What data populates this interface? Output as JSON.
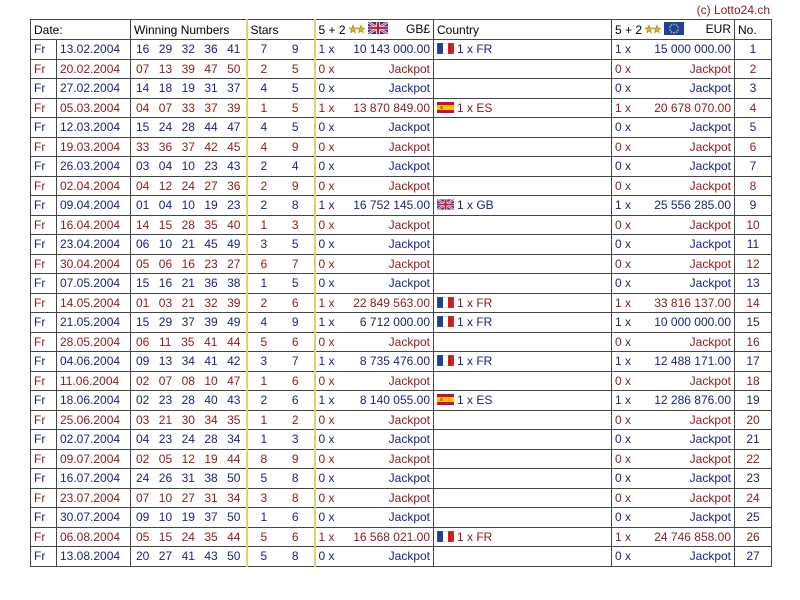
{
  "credit": "(c) Lotto24.ch",
  "headers": {
    "date": "Date:",
    "numbers": "Winning Numbers",
    "stars": "Stars",
    "gb_combo": "5 + 2",
    "gb_currency": "GB£",
    "country": "Country",
    "eur_combo": "5 + 2",
    "eur_currency": "EUR",
    "no": "No."
  },
  "colors": {
    "blue": "#1a237e",
    "red": "#8b1a1a",
    "stars_border": "#e0d070"
  },
  "rows": [
    {
      "day": "Fr",
      "date": "13.02.2004",
      "n": [
        "16",
        "29",
        "32",
        "36",
        "41"
      ],
      "s": [
        "7",
        "9"
      ],
      "gbw": "1 x",
      "gbp": "10 143 000.00",
      "country": "1 x FR",
      "flag": "FR",
      "ew": "1 x",
      "ep": "15 000 000.00",
      "no": "1"
    },
    {
      "day": "Fr",
      "date": "20.02.2004",
      "n": [
        "07",
        "13",
        "39",
        "47",
        "50"
      ],
      "s": [
        "2",
        "5"
      ],
      "gbw": "0 x",
      "gbp": "Jackpot",
      "country": "",
      "flag": "",
      "ew": "0 x",
      "ep": "Jackpot",
      "no": "2"
    },
    {
      "day": "Fr",
      "date": "27.02.2004",
      "n": [
        "14",
        "18",
        "19",
        "31",
        "37"
      ],
      "s": [
        "4",
        "5"
      ],
      "gbw": "0 x",
      "gbp": "Jackpot",
      "country": "",
      "flag": "",
      "ew": "0 x",
      "ep": "Jackpot",
      "no": "3"
    },
    {
      "day": "Fr",
      "date": "05.03.2004",
      "n": [
        "04",
        "07",
        "33",
        "37",
        "39"
      ],
      "s": [
        "1",
        "5"
      ],
      "gbw": "1 x",
      "gbp": "13 870 849.00",
      "country": "1 x ES",
      "flag": "ES",
      "ew": "1 x",
      "ep": "20 678 070.00",
      "no": "4"
    },
    {
      "day": "Fr",
      "date": "12.03.2004",
      "n": [
        "15",
        "24",
        "28",
        "44",
        "47"
      ],
      "s": [
        "4",
        "5"
      ],
      "gbw": "0 x",
      "gbp": "Jackpot",
      "country": "",
      "flag": "",
      "ew": "0 x",
      "ep": "Jackpot",
      "no": "5"
    },
    {
      "day": "Fr",
      "date": "19.03.2004",
      "n": [
        "33",
        "36",
        "37",
        "42",
        "45"
      ],
      "s": [
        "4",
        "9"
      ],
      "gbw": "0 x",
      "gbp": "Jackpot",
      "country": "",
      "flag": "",
      "ew": "0 x",
      "ep": "Jackpot",
      "no": "6"
    },
    {
      "day": "Fr",
      "date": "26.03.2004",
      "n": [
        "03",
        "04",
        "10",
        "23",
        "43"
      ],
      "s": [
        "2",
        "4"
      ],
      "gbw": "0 x",
      "gbp": "Jackpot",
      "country": "",
      "flag": "",
      "ew": "0 x",
      "ep": "Jackpot",
      "no": "7"
    },
    {
      "day": "Fr",
      "date": "02.04.2004",
      "n": [
        "04",
        "12",
        "24",
        "27",
        "36"
      ],
      "s": [
        "2",
        "9"
      ],
      "gbw": "0 x",
      "gbp": "Jackpot",
      "country": "",
      "flag": "",
      "ew": "0 x",
      "ep": "Jackpot",
      "no": "8"
    },
    {
      "day": "Fr",
      "date": "09.04.2004",
      "n": [
        "01",
        "04",
        "10",
        "19",
        "23"
      ],
      "s": [
        "2",
        "8"
      ],
      "gbw": "1 x",
      "gbp": "16 752 145.00",
      "country": "1 x GB",
      "flag": "GB",
      "ew": "1 x",
      "ep": "25 556 285.00",
      "no": "9"
    },
    {
      "day": "Fr",
      "date": "16.04.2004",
      "n": [
        "14",
        "15",
        "28",
        "35",
        "40"
      ],
      "s": [
        "1",
        "3"
      ],
      "gbw": "0 x",
      "gbp": "Jackpot",
      "country": "",
      "flag": "",
      "ew": "0 x",
      "ep": "Jackpot",
      "no": "10"
    },
    {
      "day": "Fr",
      "date": "23.04.2004",
      "n": [
        "06",
        "10",
        "21",
        "45",
        "49"
      ],
      "s": [
        "3",
        "5"
      ],
      "gbw": "0 x",
      "gbp": "Jackpot",
      "country": "",
      "flag": "",
      "ew": "0 x",
      "ep": "Jackpot",
      "no": "11"
    },
    {
      "day": "Fr",
      "date": "30.04.2004",
      "n": [
        "05",
        "06",
        "16",
        "23",
        "27"
      ],
      "s": [
        "6",
        "7"
      ],
      "gbw": "0 x",
      "gbp": "Jackpot",
      "country": "",
      "flag": "",
      "ew": "0 x",
      "ep": "Jackpot",
      "no": "12"
    },
    {
      "day": "Fr",
      "date": "07.05.2004",
      "n": [
        "15",
        "16",
        "21",
        "36",
        "38"
      ],
      "s": [
        "1",
        "5"
      ],
      "gbw": "0 x",
      "gbp": "Jackpot",
      "country": "",
      "flag": "",
      "ew": "0 x",
      "ep": "Jackpot",
      "no": "13"
    },
    {
      "day": "Fr",
      "date": "14.05.2004",
      "n": [
        "01",
        "03",
        "21",
        "32",
        "39"
      ],
      "s": [
        "2",
        "6"
      ],
      "gbw": "1 x",
      "gbp": "22 849 563.00",
      "country": "1 x FR",
      "flag": "FR",
      "ew": "1 x",
      "ep": "33 816 137.00",
      "no": "14"
    },
    {
      "day": "Fr",
      "date": "21.05.2004",
      "n": [
        "15",
        "29",
        "37",
        "39",
        "49"
      ],
      "s": [
        "4",
        "9"
      ],
      "gbw": "1 x",
      "gbp": "6 712 000.00",
      "country": "1 x FR",
      "flag": "FR",
      "ew": "1 x",
      "ep": "10 000 000.00",
      "no": "15"
    },
    {
      "day": "Fr",
      "date": "28.05.2004",
      "n": [
        "06",
        "11",
        "35",
        "41",
        "44"
      ],
      "s": [
        "5",
        "6"
      ],
      "gbw": "0 x",
      "gbp": "Jackpot",
      "country": "",
      "flag": "",
      "ew": "0 x",
      "ep": "Jackpot",
      "no": "16"
    },
    {
      "day": "Fr",
      "date": "04.06.2004",
      "n": [
        "09",
        "13",
        "34",
        "41",
        "42"
      ],
      "s": [
        "3",
        "7"
      ],
      "gbw": "1 x",
      "gbp": "8 735 476.00",
      "country": "1 x FR",
      "flag": "FR",
      "ew": "1 x",
      "ep": "12 488 171.00",
      "no": "17"
    },
    {
      "day": "Fr",
      "date": "11.06.2004",
      "n": [
        "02",
        "07",
        "08",
        "10",
        "47"
      ],
      "s": [
        "1",
        "6"
      ],
      "gbw": "0 x",
      "gbp": "Jackpot",
      "country": "",
      "flag": "",
      "ew": "0 x",
      "ep": "Jackpot",
      "no": "18"
    },
    {
      "day": "Fr",
      "date": "18.06.2004",
      "n": [
        "02",
        "23",
        "28",
        "40",
        "43"
      ],
      "s": [
        "2",
        "6"
      ],
      "gbw": "1 x",
      "gbp": "8 140 055.00",
      "country": "1 x ES",
      "flag": "ES",
      "ew": "1 x",
      "ep": "12 286 876.00",
      "no": "19"
    },
    {
      "day": "Fr",
      "date": "25.06.2004",
      "n": [
        "03",
        "21",
        "30",
        "34",
        "35"
      ],
      "s": [
        "1",
        "2"
      ],
      "gbw": "0 x",
      "gbp": "Jackpot",
      "country": "",
      "flag": "",
      "ew": "0 x",
      "ep": "Jackpot",
      "no": "20"
    },
    {
      "day": "Fr",
      "date": "02.07.2004",
      "n": [
        "04",
        "23",
        "24",
        "28",
        "34"
      ],
      "s": [
        "1",
        "3"
      ],
      "gbw": "0 x",
      "gbp": "Jackpot",
      "country": "",
      "flag": "",
      "ew": "0 x",
      "ep": "Jackpot",
      "no": "21"
    },
    {
      "day": "Fr",
      "date": "09.07.2004",
      "n": [
        "02",
        "05",
        "12",
        "19",
        "44"
      ],
      "s": [
        "8",
        "9"
      ],
      "gbw": "0 x",
      "gbp": "Jackpot",
      "country": "",
      "flag": "",
      "ew": "0 x",
      "ep": "Jackpot",
      "no": "22"
    },
    {
      "day": "Fr",
      "date": "16.07.2004",
      "n": [
        "24",
        "26",
        "31",
        "38",
        "50"
      ],
      "s": [
        "5",
        "8"
      ],
      "gbw": "0 x",
      "gbp": "Jackpot",
      "country": "",
      "flag": "",
      "ew": "0 x",
      "ep": "Jackpot",
      "no": "23"
    },
    {
      "day": "Fr",
      "date": "23.07.2004",
      "n": [
        "07",
        "10",
        "27",
        "31",
        "34"
      ],
      "s": [
        "3",
        "8"
      ],
      "gbw": "0 x",
      "gbp": "Jackpot",
      "country": "",
      "flag": "",
      "ew": "0 x",
      "ep": "Jackpot",
      "no": "24"
    },
    {
      "day": "Fr",
      "date": "30.07.2004",
      "n": [
        "09",
        "10",
        "19",
        "37",
        "50"
      ],
      "s": [
        "1",
        "6"
      ],
      "gbw": "0 x",
      "gbp": "Jackpot",
      "country": "",
      "flag": "",
      "ew": "0 x",
      "ep": "Jackpot",
      "no": "25"
    },
    {
      "day": "Fr",
      "date": "06.08.2004",
      "n": [
        "05",
        "15",
        "24",
        "35",
        "44"
      ],
      "s": [
        "5",
        "6"
      ],
      "gbw": "1 x",
      "gbp": "16 568 021.00",
      "country": "1 x FR",
      "flag": "FR",
      "ew": "1 x",
      "ep": "24 746 858.00",
      "no": "26"
    },
    {
      "day": "Fr",
      "date": "13.08.2004",
      "n": [
        "20",
        "27",
        "41",
        "43",
        "50"
      ],
      "s": [
        "5",
        "8"
      ],
      "gbw": "0 x",
      "gbp": "Jackpot",
      "country": "",
      "flag": "",
      "ew": "0 x",
      "ep": "Jackpot",
      "no": "27"
    }
  ]
}
